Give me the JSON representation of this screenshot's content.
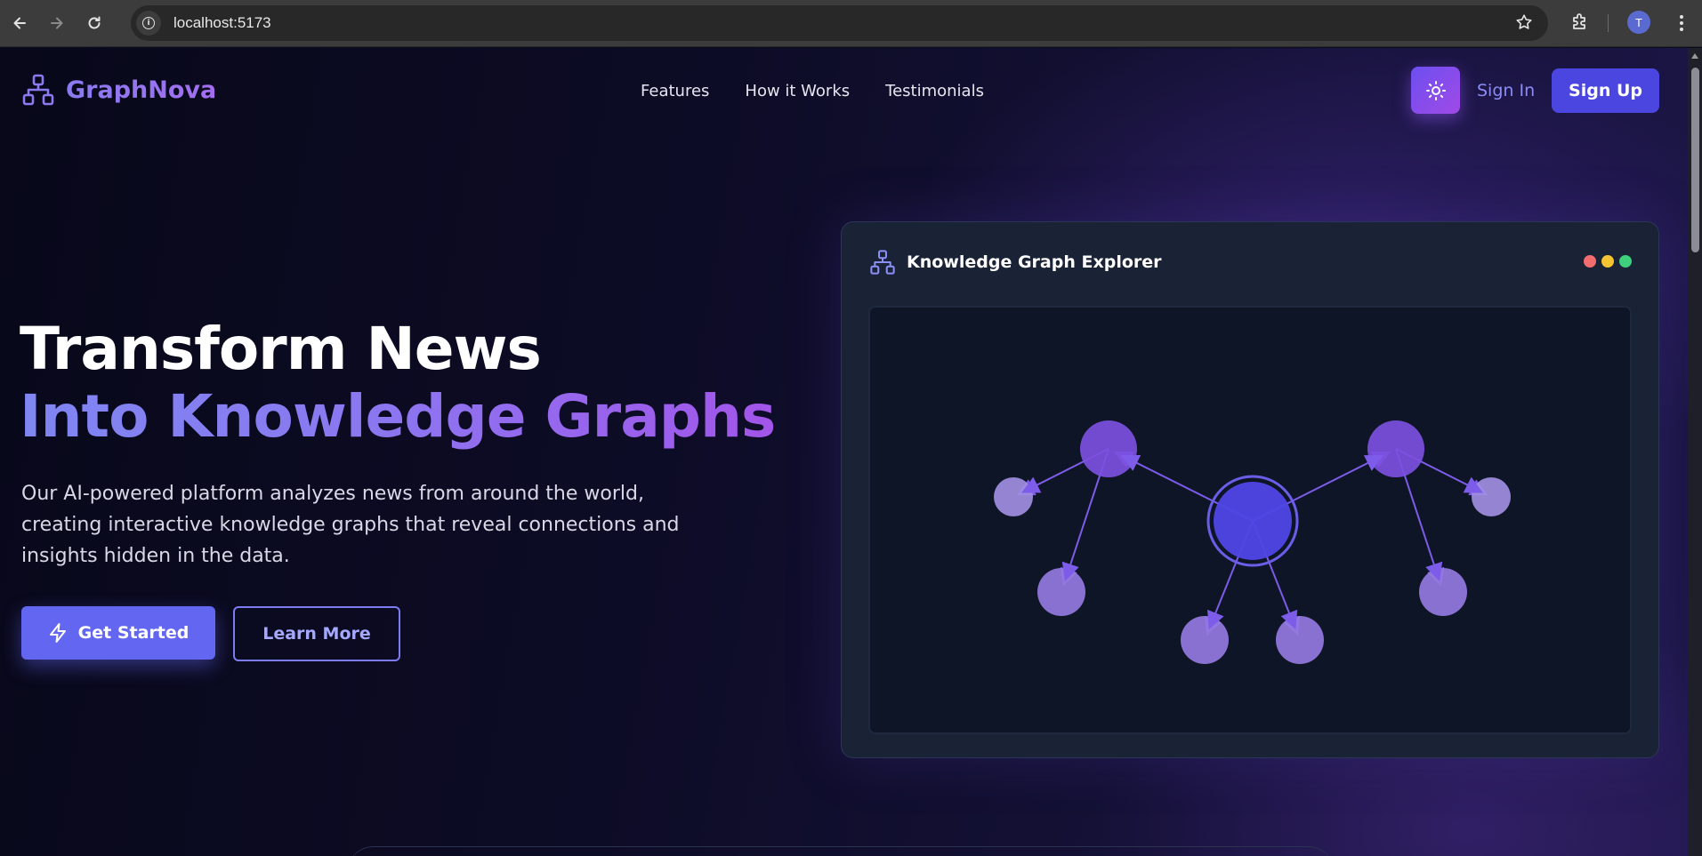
{
  "browser": {
    "url": "localhost:5173",
    "profile_initial": "T"
  },
  "nav": {
    "brand": "GraphNova",
    "links": [
      {
        "label": "Features"
      },
      {
        "label": "How it Works"
      },
      {
        "label": "Testimonials"
      }
    ],
    "sign_in": "Sign In",
    "sign_up": "Sign Up"
  },
  "hero": {
    "title_line1": "Transform News",
    "title_line2": "Into Knowledge Graphs",
    "description": "Our AI-powered platform analyzes news from around the world, creating interactive knowledge graphs that reveal connections and insights hidden in the data.",
    "primary_button": "Get Started",
    "secondary_button": "Learn More"
  },
  "explorer": {
    "title": "Knowledge Graph Explorer",
    "window_dot_colors": [
      "#f26d6d",
      "#f5c431",
      "#3fd07e"
    ],
    "node_color_main": "#4f46e5",
    "node_color_hub": "#7c50df",
    "node_color_leaf": "#9479df",
    "edge_color": "#7c5ce8"
  }
}
